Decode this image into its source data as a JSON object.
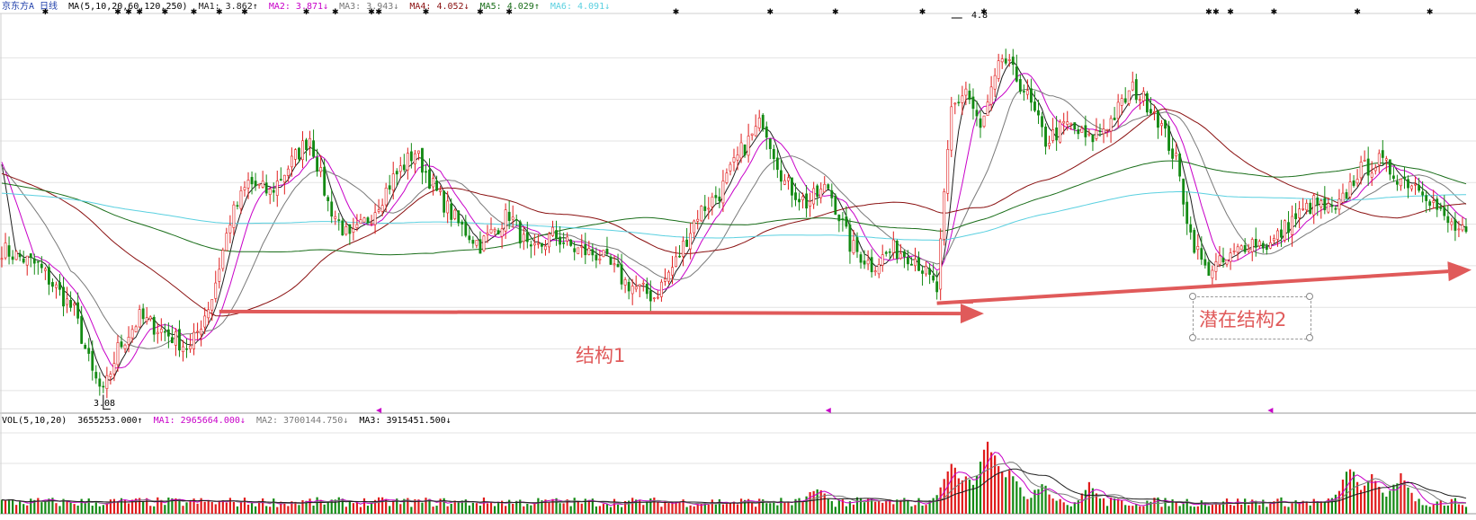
{
  "colors": {
    "up": "#e01c1c",
    "down": "#138a13",
    "ma1": "#1f1f1f",
    "ma2": "#c800c8",
    "ma3": "#7a7a7a",
    "ma4": "#8a1010",
    "ma5": "#1a6e1a",
    "ma6": "#5ad0e0",
    "annotation": "#e05a5a"
  },
  "price_header": {
    "title": "京东方A 日线",
    "ma_params": "MA(5,10,20,60,120,250)",
    "ma1": "MA1: 3.862↑",
    "ma2": "MA2: 3.871↓",
    "ma3": "MA3: 3.943↓",
    "ma4": "MA4: 4.052↓",
    "ma5": "MA5: 4.029↑",
    "ma6": "MA6: 4.091↓"
  },
  "volume_header": {
    "params": "VOL(5,10,20)",
    "vol": "3655253.000↑",
    "ma1": "MA1: 2965664.000↓",
    "ma2": "MA2: 3700144.750↓",
    "ma3": "MA3: 3915451.500↓"
  },
  "annotations": {
    "structure1": "结构1",
    "structure2": "潜在结构2",
    "low_label": "3.08",
    "high_label": "4.8"
  },
  "chart_data": {
    "type": "line",
    "ylim": [
      3.0,
      4.9
    ],
    "grid": true,
    "anchors": [
      [
        0,
        3.78
      ],
      [
        10,
        3.7
      ],
      [
        20,
        3.48
      ],
      [
        25,
        3.18
      ],
      [
        28,
        3.08
      ],
      [
        32,
        3.3
      ],
      [
        38,
        3.45
      ],
      [
        45,
        3.38
      ],
      [
        52,
        3.3
      ],
      [
        58,
        3.55
      ],
      [
        63,
        3.92
      ],
      [
        68,
        4.1
      ],
      [
        74,
        4.05
      ],
      [
        80,
        4.2
      ],
      [
        85,
        4.32
      ],
      [
        90,
        4.0
      ],
      [
        96,
        3.82
      ],
      [
        102,
        3.95
      ],
      [
        108,
        4.12
      ],
      [
        114,
        4.25
      ],
      [
        120,
        4.05
      ],
      [
        126,
        3.9
      ],
      [
        132,
        3.8
      ],
      [
        140,
        3.95
      ],
      [
        146,
        3.75
      ],
      [
        152,
        3.85
      ],
      [
        158,
        3.78
      ],
      [
        165,
        3.75
      ],
      [
        172,
        3.62
      ],
      [
        180,
        3.55
      ],
      [
        186,
        3.72
      ],
      [
        192,
        3.95
      ],
      [
        198,
        4.05
      ],
      [
        204,
        4.25
      ],
      [
        210,
        4.4
      ],
      [
        216,
        4.1
      ],
      [
        222,
        4.0
      ],
      [
        228,
        4.08
      ],
      [
        234,
        3.8
      ],
      [
        240,
        3.7
      ],
      [
        246,
        3.78
      ],
      [
        252,
        3.74
      ],
      [
        258,
        3.58
      ],
      [
        262,
        4.45
      ],
      [
        266,
        4.55
      ],
      [
        270,
        4.35
      ],
      [
        276,
        4.7
      ],
      [
        282,
        4.55
      ],
      [
        288,
        4.3
      ],
      [
        294,
        4.38
      ],
      [
        300,
        4.3
      ],
      [
        306,
        4.4
      ],
      [
        312,
        4.55
      ],
      [
        318,
        4.45
      ],
      [
        324,
        4.2
      ],
      [
        328,
        3.85
      ],
      [
        332,
        3.68
      ],
      [
        338,
        3.72
      ],
      [
        344,
        3.82
      ],
      [
        350,
        3.8
      ],
      [
        356,
        3.92
      ],
      [
        362,
        4.0
      ],
      [
        368,
        3.95
      ],
      [
        374,
        4.15
      ],
      [
        380,
        4.2
      ],
      [
        386,
        4.12
      ],
      [
        392,
        4.08
      ],
      [
        398,
        3.92
      ],
      [
        404,
        3.84
      ]
    ],
    "n": 405,
    "ma_periods": [
      5,
      10,
      20,
      60,
      120,
      250
    ],
    "ma_seed": [
      4.3,
      4.25,
      4.2,
      4.15,
      4.1,
      4.05
    ],
    "vol_spikes": [
      [
        225,
        2.2
      ],
      [
        262,
        4.5
      ],
      [
        266,
        3.2
      ],
      [
        272,
        6.5
      ],
      [
        274,
        5.0
      ],
      [
        278,
        3.8
      ],
      [
        287,
        2.6
      ],
      [
        300,
        2.4
      ],
      [
        372,
        4.0
      ],
      [
        378,
        3.5
      ],
      [
        386,
        3.2
      ]
    ],
    "structure1_line": {
      "x1": 60,
      "y1": 3.48,
      "x2": 268,
      "y2": 3.47
    },
    "structure2_line": {
      "x1": 258,
      "y1": 3.52,
      "x2": 404,
      "y2": 3.68
    },
    "star_markers": [
      12,
      32,
      35,
      38,
      45,
      53,
      60,
      67,
      84,
      92,
      102,
      104,
      117,
      132,
      140,
      186,
      212,
      230,
      254,
      271,
      333,
      335,
      339,
      351,
      374,
      394
    ],
    "triangle_markers": [
      104,
      228,
      350
    ]
  }
}
